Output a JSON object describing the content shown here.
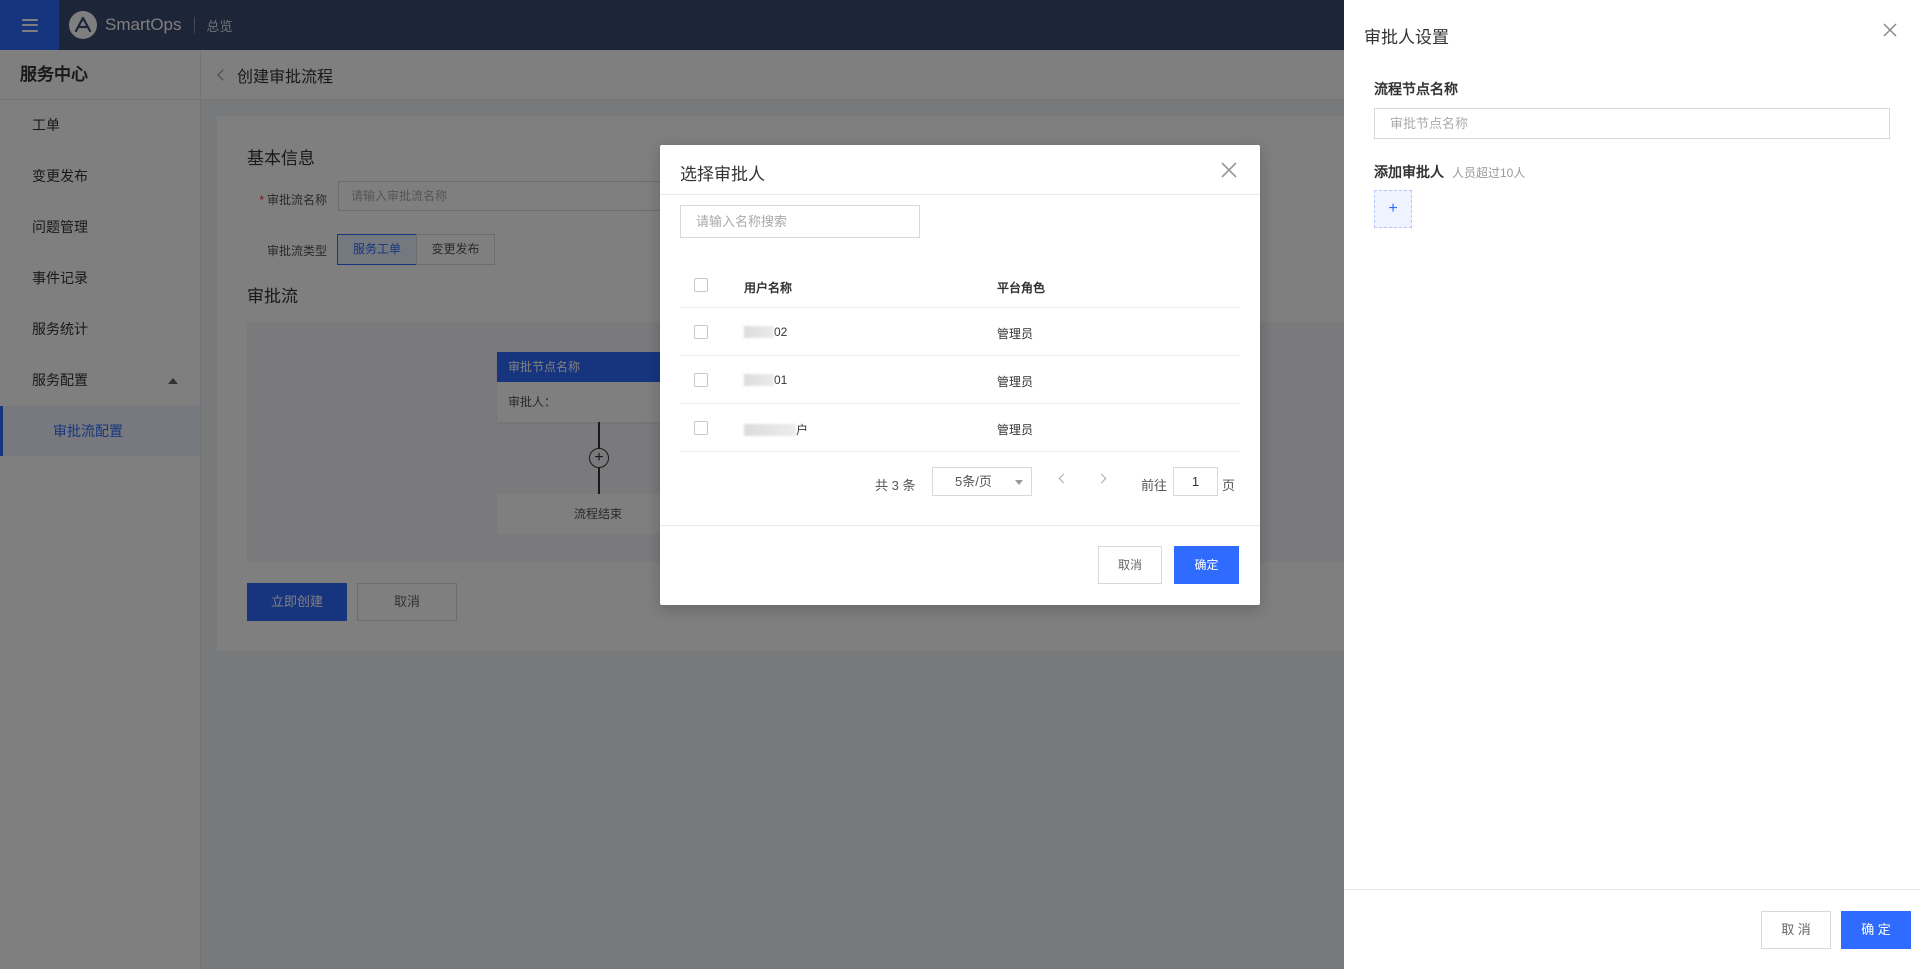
{
  "topbar": {
    "brand": "SmartOps",
    "overview": "总览",
    "icons": {
      "menu": "hamburger-icon",
      "logo": "smartops-logo"
    }
  },
  "sidebar": {
    "title": "服务中心",
    "items": [
      {
        "label": "工单"
      },
      {
        "label": "变更发布"
      },
      {
        "label": "问题管理"
      },
      {
        "label": "事件记录"
      },
      {
        "label": "服务统计"
      },
      {
        "label": "服务配置"
      }
    ],
    "sub_item": "审批流配置"
  },
  "main": {
    "breadcrumb": "创建审批流程",
    "basic_info": "基本信息",
    "name_label": "审批流名称",
    "name_placeholder": "请输入审批流名称",
    "type_label": "审批流类型",
    "types": [
      "服务工单",
      "变更发布"
    ],
    "flow_title": "审批流",
    "node_title": "审批节点名称",
    "node_approver": "审批人：",
    "flow_end": "流程结束",
    "create_button": "立即创建",
    "cancel_button": "取消"
  },
  "drawer": {
    "title": "审批人设置",
    "node_name_label": "流程节点名称",
    "node_name_placeholder": "审批节点名称",
    "add_label": "添加审批人",
    "add_hint": "人员超过10人",
    "add_symbol": "+",
    "cancel": "取 消",
    "confirm": "确 定"
  },
  "modal": {
    "title": "选择审批人",
    "search_placeholder": "请输入名称搜索",
    "columns": [
      "用户名称",
      "平台角色"
    ],
    "rows": [
      {
        "name_suffix": "02",
        "role": "管理员"
      },
      {
        "name_suffix": "01",
        "role": "管理员"
      },
      {
        "name_suffix": "户",
        "role": "管理员"
      }
    ],
    "pagination": {
      "total": "共 3 条",
      "page_size": "5条/页",
      "goto": "前往",
      "page": "1",
      "page_unit": "页"
    },
    "cancel": "取消",
    "confirm": "确定"
  },
  "colors": {
    "primary": "#2f6bff",
    "topbar": "#3b4a70",
    "overlay": "rgba(0,0,0,0.5)"
  }
}
